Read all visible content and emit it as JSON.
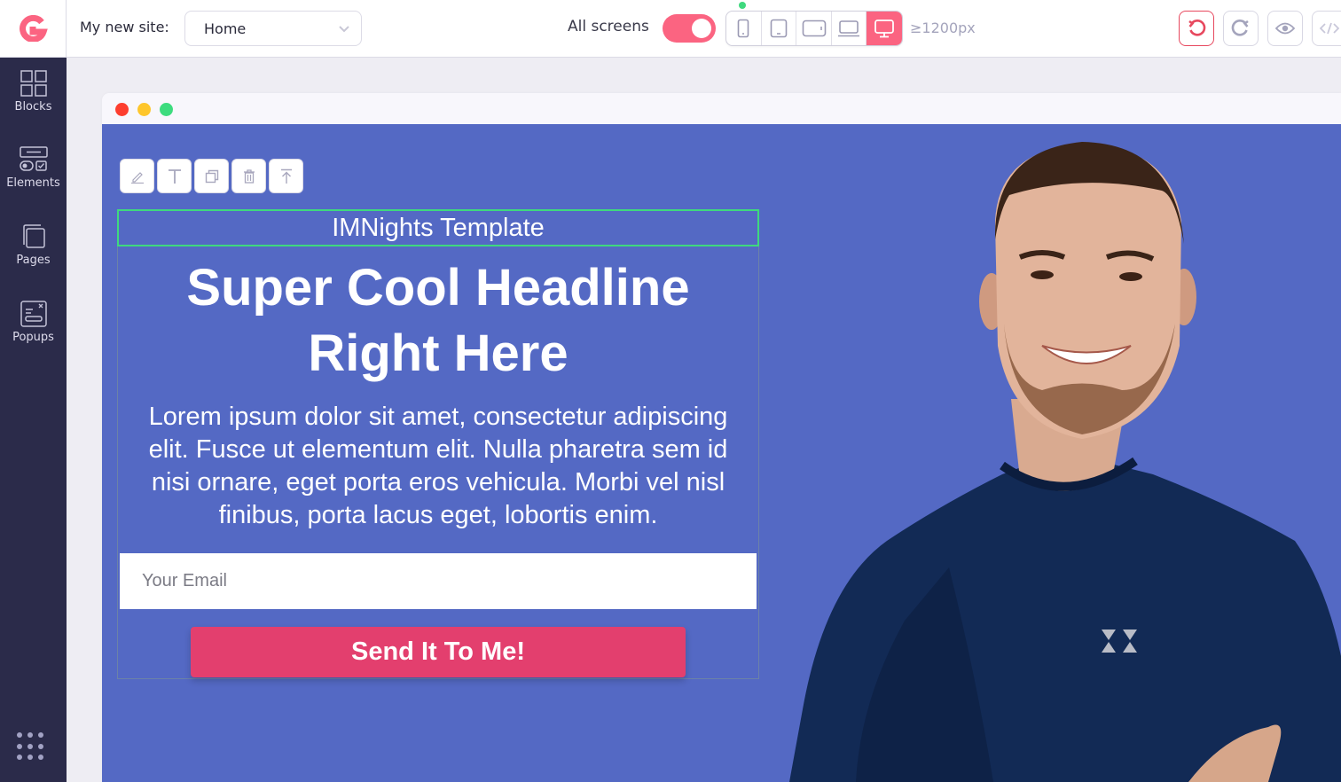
{
  "topbar": {
    "logo": "brand-logo",
    "site_label": "My new site:",
    "page_select": {
      "value": "Home"
    },
    "screens_label": "All screens",
    "all_screens_toggle": {
      "on": true
    },
    "devices": [
      {
        "name": "mobile",
        "active": false
      },
      {
        "name": "tablet-portrait",
        "active": false
      },
      {
        "name": "tablet-landscape",
        "active": false
      },
      {
        "name": "laptop",
        "active": false
      },
      {
        "name": "desktop",
        "active": true
      }
    ],
    "breakpoint_label": "≥1200px",
    "actions": [
      "undo",
      "redo",
      "preview",
      "code"
    ]
  },
  "sidebar": {
    "items": [
      {
        "label": "Blocks",
        "icon": "blocks-icon"
      },
      {
        "label": "Elements",
        "icon": "elements-icon"
      },
      {
        "label": "Pages",
        "icon": "pages-icon"
      },
      {
        "label": "Popups",
        "icon": "popups-icon"
      }
    ],
    "apps_icon": "apps-grid-icon"
  },
  "canvas": {
    "element_toolbar": [
      "edit",
      "text",
      "duplicate",
      "delete",
      "move-up"
    ],
    "selected_text": "IMNights Template",
    "headline": "Super Cool Headline Right Here",
    "body": "Lorem ipsum dolor sit amet, consectetur adipiscing elit. Fusce ut elementum elit. Nulla pharetra sem id nisi ornare, eget porta eros vehicula. Morbi vel nisl finibus, porta lacus eget, lobortis enim.",
    "email_placeholder": "Your Email",
    "cta_label": "Send It To Me!",
    "image_alt": "Smiling man in navy shirt with arms crossed"
  },
  "colors": {
    "accent": "#fb6481",
    "sidebar_bg": "#2b2b4a",
    "page_bg": "#5469c4",
    "cta": "#e33f6e",
    "selection": "#3fd97e"
  }
}
